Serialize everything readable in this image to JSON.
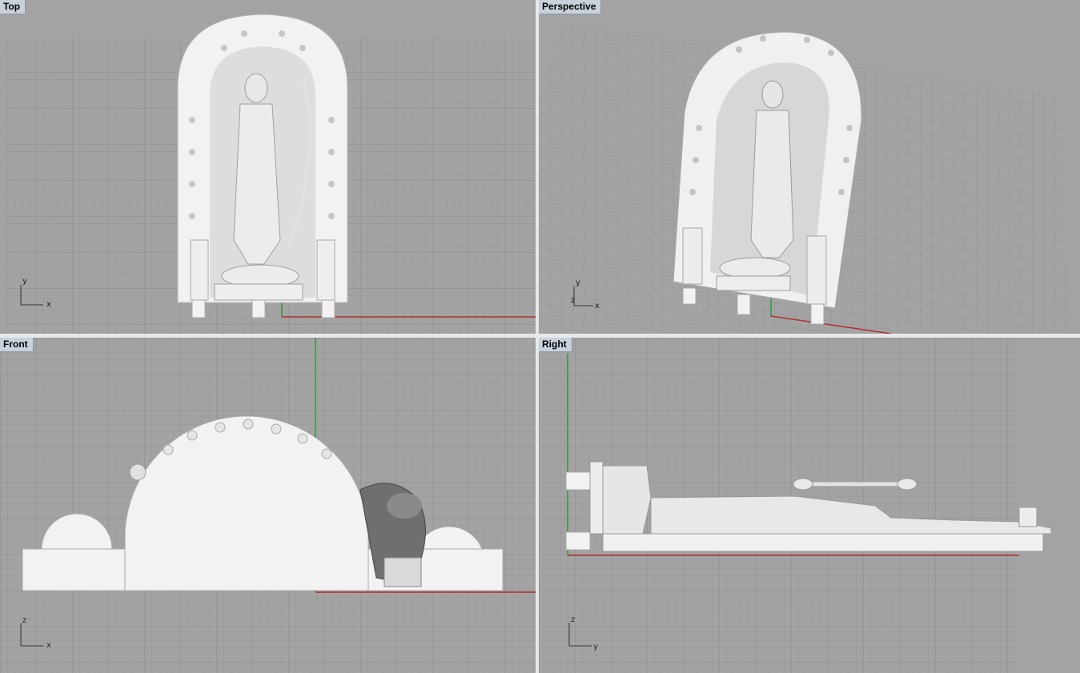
{
  "viewports": [
    {
      "id": "top",
      "label": "Top",
      "axes": [
        "y",
        "x"
      ]
    },
    {
      "id": "perspective",
      "label": "Perspective",
      "axes": [
        "y",
        "z",
        "x"
      ]
    },
    {
      "id": "front",
      "label": "Front",
      "axes": [
        "z",
        "x"
      ]
    },
    {
      "id": "right",
      "label": "Right",
      "axes": [
        "z",
        "y"
      ]
    }
  ],
  "colors": {
    "background": "#a3a3a3",
    "grid_minor": "#9a9a9a",
    "grid_major": "#8b8b8b",
    "x_axis": "#b03030",
    "y_axis": "#2f9a3a",
    "model": "#f2f2f2",
    "model_shade": "#b5b5b5",
    "label_bg": "#c8d1dc"
  }
}
